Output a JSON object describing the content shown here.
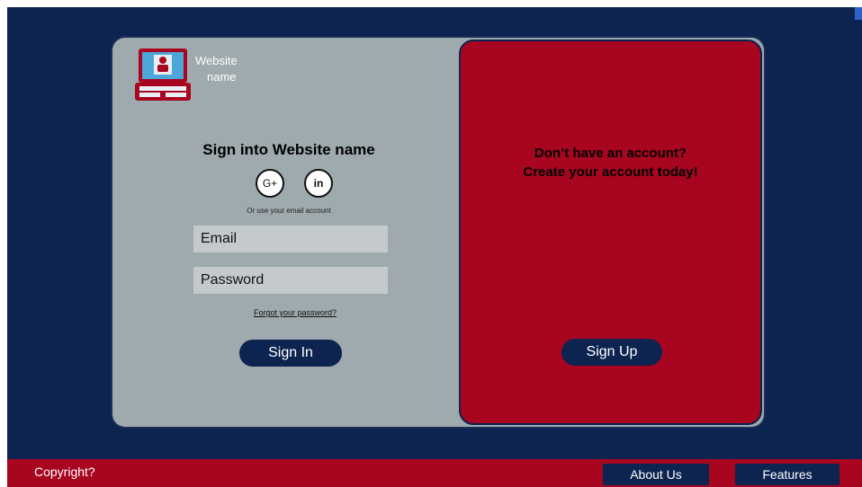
{
  "brand": {
    "name_line1": "Website",
    "name_line2": "name"
  },
  "signin": {
    "title": "Sign into Website name",
    "social": {
      "google": "G+",
      "linkedin": "in"
    },
    "alt_text": "Or use your email account",
    "email_placeholder": "Email",
    "password_placeholder": "Password",
    "forgot_label": "Forgot your password?",
    "submit_label": "Sign In"
  },
  "signup": {
    "line1": "Don’t have an account?",
    "line2": "Create your account today!",
    "button_label": "Sign Up"
  },
  "footer": {
    "copyright": "Copyright?",
    "about_label": "About Us",
    "features_label": "Features"
  },
  "colors": {
    "navy": "#0d2350",
    "crimson": "#a80520",
    "panel_gray": "#9eaaad"
  },
  "icons": {
    "logo": "laptop-user-icon"
  }
}
